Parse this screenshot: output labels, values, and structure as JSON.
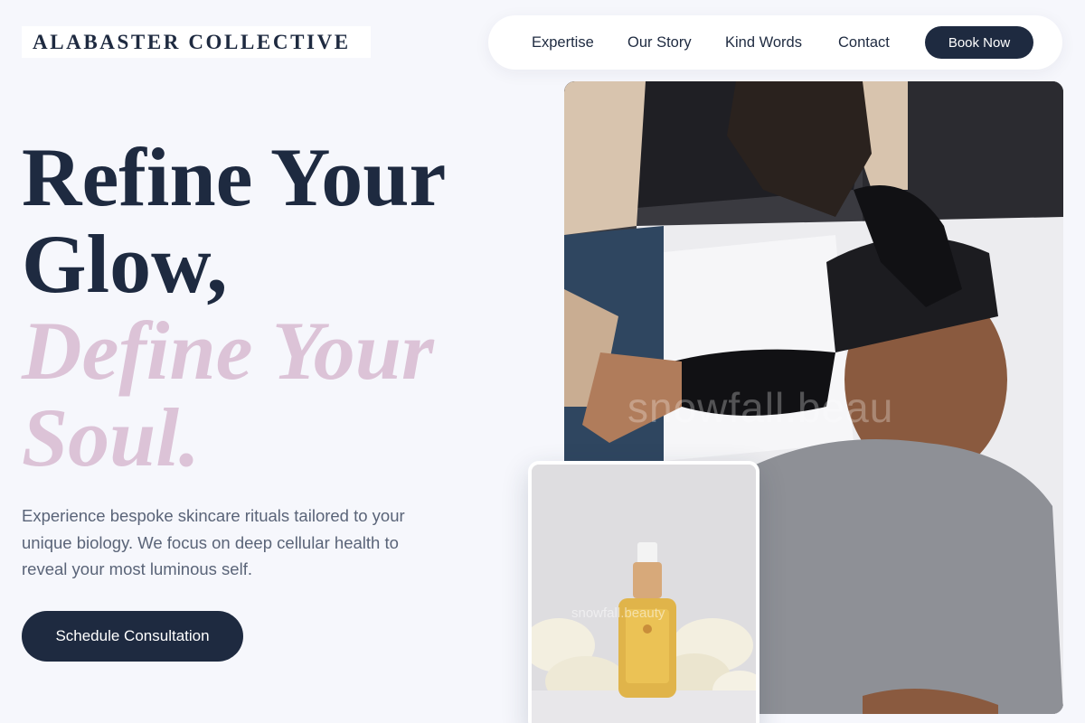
{
  "brand": {
    "name": "ALABASTER COLLECTIVE"
  },
  "nav": {
    "links": [
      "Expertise",
      "Our Story",
      "Kind Words",
      "Contact"
    ],
    "cta_label": "Book Now"
  },
  "hero": {
    "title_lines": [
      "Refine Your",
      "Glow,"
    ],
    "accent_lines": [
      "Define Your",
      "Soul."
    ],
    "description": "Experience bespoke skincare rituals tailored to your unique biology. We focus on deep cellular health to reveal your most luminous self.",
    "cta_label": "Schedule Consultation"
  },
  "images": {
    "main_watermark": "snowfall.beau",
    "product_watermark": "snowfall.beauty"
  },
  "colors": {
    "navy": "#1e2a40",
    "accent_mauve": "#dcc3d7",
    "background": "#f6f7fc",
    "text_muted": "#5a6478"
  }
}
